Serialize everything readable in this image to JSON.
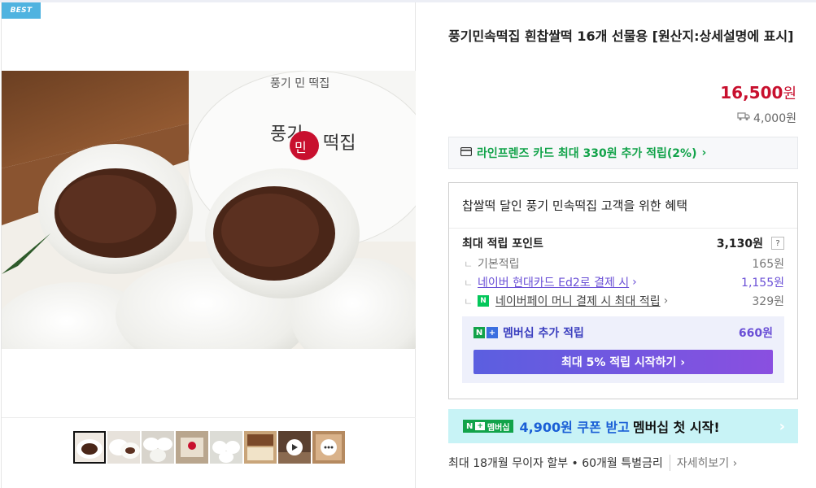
{
  "badge": "BEST",
  "product": {
    "title": "풍기민속떡집 흰찹쌀떡 16개 선물용 [원산지:상세설명에 표시]",
    "price": "16,500",
    "price_unit": "원",
    "shipping_fee": "4,000원",
    "shipping_icon": "truck-icon"
  },
  "card_promo": {
    "icon": "card-icon",
    "text": "라인프렌즈 카드 최대 330원 추가 적립(2%)",
    "chevron": "›"
  },
  "benefit": {
    "title": "찹쌀떡 달인 풍기 민속떡집 고객을 위한 혜택",
    "max_points_label": "최대 적립 포인트",
    "max_points_value": "3,130원",
    "help": "?",
    "rows": [
      {
        "branch": "ㄴ",
        "label": "기본적립",
        "value": "165원"
      },
      {
        "branch": "ㄴ",
        "label": "네이버 현대카드 Ed2로 결제 시",
        "chevron": "›",
        "value": "1,155원"
      },
      {
        "branch": "ㄴ",
        "badge": "N",
        "label": "네이버페이 머니 결제 시 최대 적립",
        "chevron": "›",
        "value": "329원"
      }
    ],
    "membership": {
      "n_label": "N",
      "plus_label": "+",
      "label": "멤버십 추가 적립",
      "value": "660원",
      "button": "최대 5% 적립 시작하기 ›"
    }
  },
  "coupon": {
    "badge_n": "N",
    "badge_plus": "+",
    "badge_text": "멤버십",
    "amount": "4,900원 쿠폰 받고",
    "text": "멤버십 첫 시작!",
    "chevron": "›"
  },
  "installment": {
    "text": "최대 18개월 무이자 할부 • 60개월 특별금리",
    "more": "자세히보기 ›"
  },
  "colors": {
    "price": "#c8102e",
    "green": "#12a34a",
    "purple": "#6a4fd6",
    "coupon_bg": "#c8f3f6"
  },
  "thumbnails": [
    {
      "name": "thumb-1",
      "selected": true
    },
    {
      "name": "thumb-2"
    },
    {
      "name": "thumb-3"
    },
    {
      "name": "thumb-4"
    },
    {
      "name": "thumb-5"
    },
    {
      "name": "thumb-6"
    },
    {
      "name": "thumb-video",
      "icon": "play-icon"
    },
    {
      "name": "thumb-more",
      "icon": "chat-icon"
    }
  ]
}
